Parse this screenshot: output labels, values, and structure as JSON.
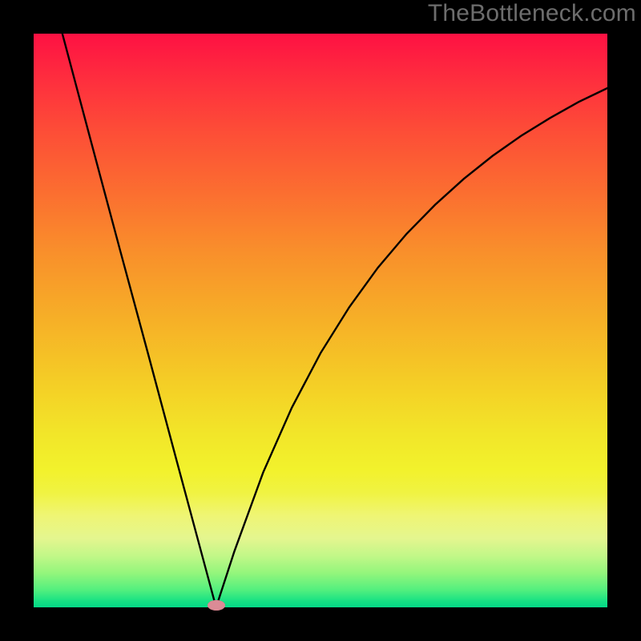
{
  "watermark": "TheBottleneck.com",
  "chart_data": {
    "type": "line",
    "title": "",
    "xlabel": "",
    "ylabel": "",
    "xlim": [
      0,
      1
    ],
    "ylim": [
      0,
      1
    ],
    "grid": false,
    "legend": false,
    "background_gradient": {
      "direction": "vertical",
      "stops": [
        {
          "pos": 0.0,
          "color": "#fe1143"
        },
        {
          "pos": 0.5,
          "color": "#f6b027"
        },
        {
          "pos": 0.8,
          "color": "#f0f342"
        },
        {
          "pos": 1.0,
          "color": "#04d987"
        }
      ]
    },
    "series": [
      {
        "name": "curve",
        "color": "#000000",
        "x": [
          0.05,
          0.1,
          0.15,
          0.2,
          0.25,
          0.3,
          0.318,
          0.35,
          0.4,
          0.45,
          0.5,
          0.55,
          0.6,
          0.65,
          0.7,
          0.75,
          0.8,
          0.85,
          0.9,
          0.95,
          1.0
        ],
        "y": [
          1.0,
          0.812,
          0.625,
          0.44,
          0.253,
          0.067,
          0.0,
          0.098,
          0.235,
          0.348,
          0.443,
          0.523,
          0.592,
          0.651,
          0.702,
          0.747,
          0.787,
          0.822,
          0.853,
          0.881,
          0.905
        ]
      }
    ],
    "marker": {
      "name": "bottleneck-point",
      "shape": "ellipse",
      "color": "#db8b96",
      "x": 0.318,
      "y": 0.0
    }
  }
}
